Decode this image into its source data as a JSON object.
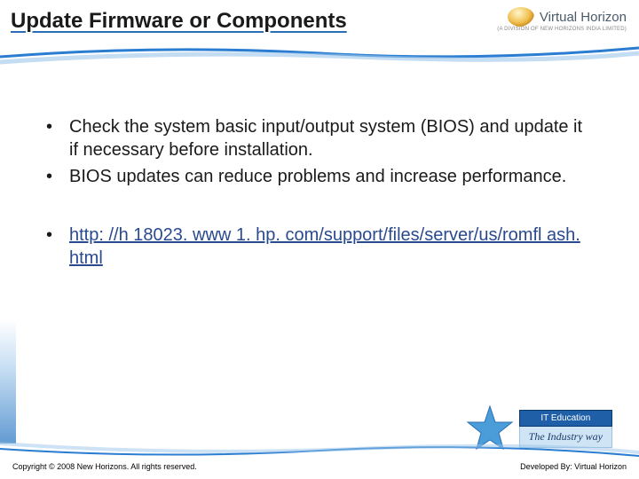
{
  "header": {
    "title": "Update Firmware or Components",
    "logo_text": "Virtual Horizon",
    "logo_sub": "(A DIVISION OF NEW HORIZONS INDIA LIMITED)"
  },
  "content": {
    "bullets_a": [
      "Check the system basic input/output system (BIOS) and update it if necessary before installation.",
      "BIOS updates can reduce problems and increase performance."
    ],
    "bullets_b": [
      "http: //h 18023. www 1. hp. com/support/files/server/us/romfl ash. html"
    ]
  },
  "badge": {
    "top_label": "IT Education",
    "bottom_label": "The Industry way"
  },
  "footer": {
    "left": "Copyright © 2008 New Horizons. All rights reserved.",
    "right": "Developed By: Virtual Horizon"
  }
}
